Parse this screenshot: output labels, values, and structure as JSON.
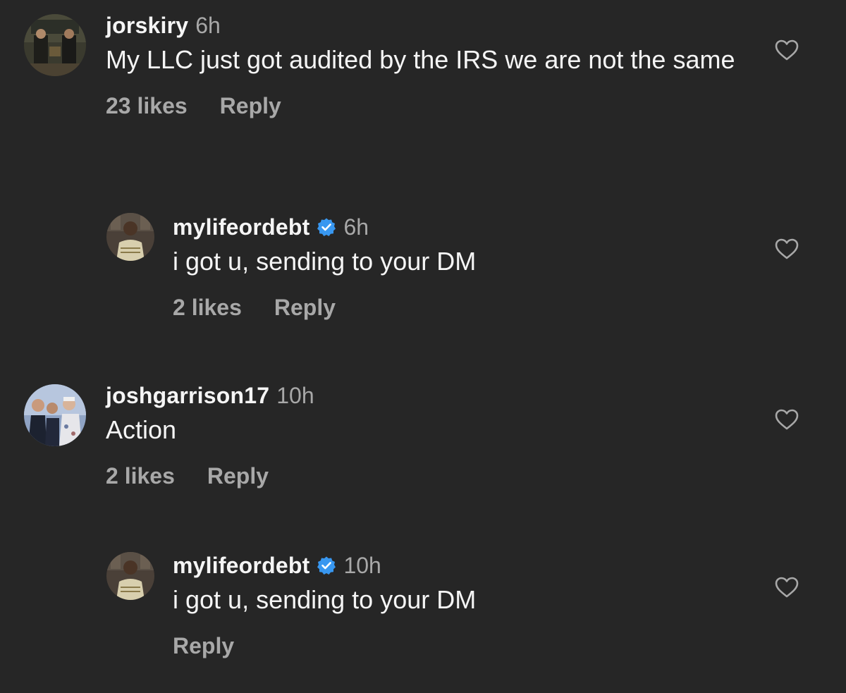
{
  "comments": [
    {
      "username": "jorskiry",
      "verified": false,
      "time": "6h",
      "text": "My LLC just got audited by the IRS we are not the same",
      "likes": "23 likes",
      "reply": "Reply",
      "avatar_icon": "avatar-photo-icon"
    },
    {
      "username": "mylifeordebt",
      "verified": true,
      "time": "6h",
      "text": "i got u, sending to your DM",
      "likes": "2 likes",
      "reply": "Reply",
      "avatar_icon": "avatar-photo-icon"
    },
    {
      "username": "joshgarrison17",
      "verified": false,
      "time": "10h",
      "text": "Action",
      "likes": "2 likes",
      "reply": "Reply",
      "avatar_icon": "avatar-photo-icon"
    },
    {
      "username": "mylifeordebt",
      "verified": true,
      "time": "10h",
      "text": "i got u, sending to your DM",
      "likes": "",
      "reply": "Reply",
      "avatar_icon": "avatar-photo-icon"
    }
  ],
  "colors": {
    "background": "#262626",
    "primary_text": "#f5f5f5",
    "secondary_text": "#a8a8a8",
    "verified_blue": "#3897f0"
  },
  "icons": {
    "like": "heart-outline-icon",
    "verified": "verified-badge-icon"
  }
}
